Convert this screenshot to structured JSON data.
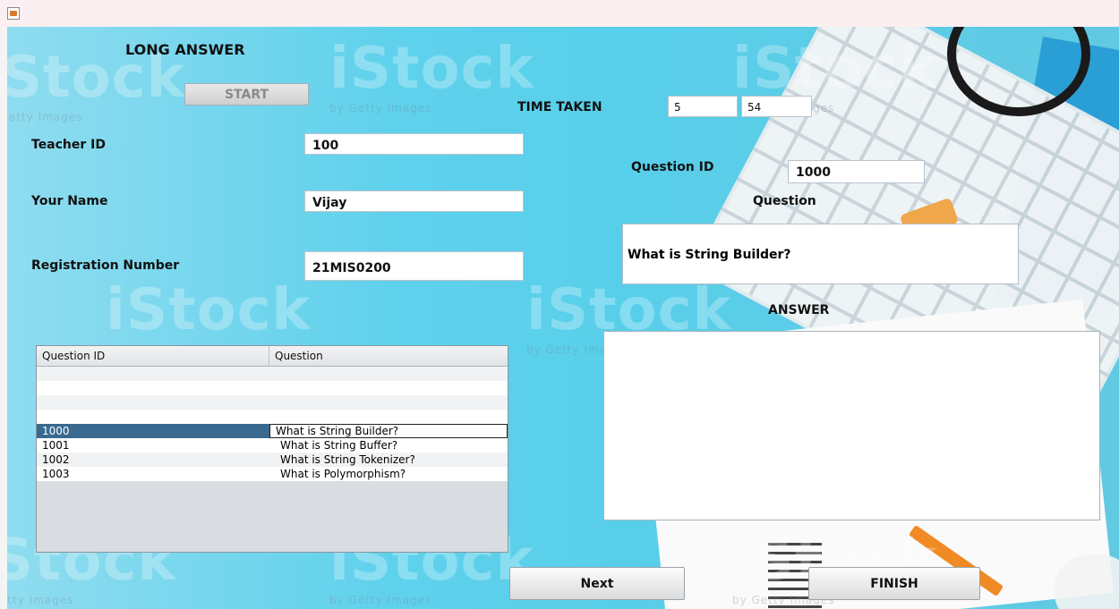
{
  "window": {
    "icon": "java-cup-icon"
  },
  "header": {
    "title": "LONG ANSWER",
    "start_label": "START"
  },
  "timer": {
    "label": "TIME TAKEN",
    "minutes": "5",
    "seconds": "54"
  },
  "form": {
    "teacher_id_label": "Teacher ID",
    "teacher_id_value": "100",
    "name_label": "Your Name",
    "name_value": "Vijay",
    "reg_label": "Registration Number",
    "reg_value": "21MIS0200"
  },
  "question_panel": {
    "id_label": "Question ID",
    "id_value": "1000",
    "question_label": "Question",
    "question_text": "What is String Builder?",
    "answer_label": "ANSWER",
    "answer_value": ""
  },
  "table": {
    "headers": [
      "Question ID",
      "Question"
    ],
    "rows": [
      {
        "id": "1000",
        "question": "What is String Builder?"
      },
      {
        "id": "1001",
        "question": "What is String Buffer?"
      },
      {
        "id": "1002",
        "question": "What is String Tokenizer?"
      },
      {
        "id": "1003",
        "question": "What is Polymorphism?"
      }
    ]
  },
  "actions": {
    "next_label": "Next",
    "finish_label": "FINISH"
  },
  "watermark": {
    "brand": "iStock",
    "tagline": "by Getty Images"
  }
}
